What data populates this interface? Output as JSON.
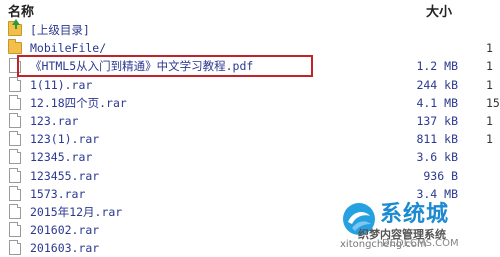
{
  "header": {
    "name_label": "名称",
    "size_label": "大小"
  },
  "rows": [
    {
      "name": "[上级目录]",
      "size": "",
      "extra": "",
      "type": "parent"
    },
    {
      "name": "MobileFile/",
      "size": "",
      "extra": "1",
      "type": "folder"
    },
    {
      "name": "《HTML5从入门到精通》中文学习教程.pdf",
      "size": "1.2 MB",
      "extra": "1",
      "type": "file",
      "highlighted": true
    },
    {
      "name": "1(11).rar",
      "size": "244 kB",
      "extra": "1",
      "type": "file"
    },
    {
      "name": "12.18四个页.rar",
      "size": "4.1 MB",
      "extra": "15",
      "type": "file"
    },
    {
      "name": "123.rar",
      "size": "137 kB",
      "extra": "1",
      "type": "file"
    },
    {
      "name": "123(1).rar",
      "size": "811 kB",
      "extra": "1",
      "type": "file"
    },
    {
      "name": "12345.rar",
      "size": "3.6 kB",
      "extra": "",
      "type": "file"
    },
    {
      "name": "123455.rar",
      "size": "936 B",
      "extra": "",
      "type": "file"
    },
    {
      "name": "1573.rar",
      "size": "3.4 MB",
      "extra": "",
      "type": "file"
    },
    {
      "name": "2015年12月.rar",
      "size": "",
      "extra": "",
      "type": "file"
    },
    {
      "name": "201602.rar",
      "size": "",
      "extra": "",
      "type": "file"
    },
    {
      "name": "201603.rar",
      "size": "",
      "extra": "",
      "type": "file"
    }
  ],
  "watermark": {
    "title": "系统城",
    "subtitle": "织梦内容管理系统",
    "url": "DEDECMS.COM",
    "url2": "xitongcheng.com",
    "colors": {
      "title": "#1c8ad0",
      "highlight_border": "#c0242a"
    }
  }
}
